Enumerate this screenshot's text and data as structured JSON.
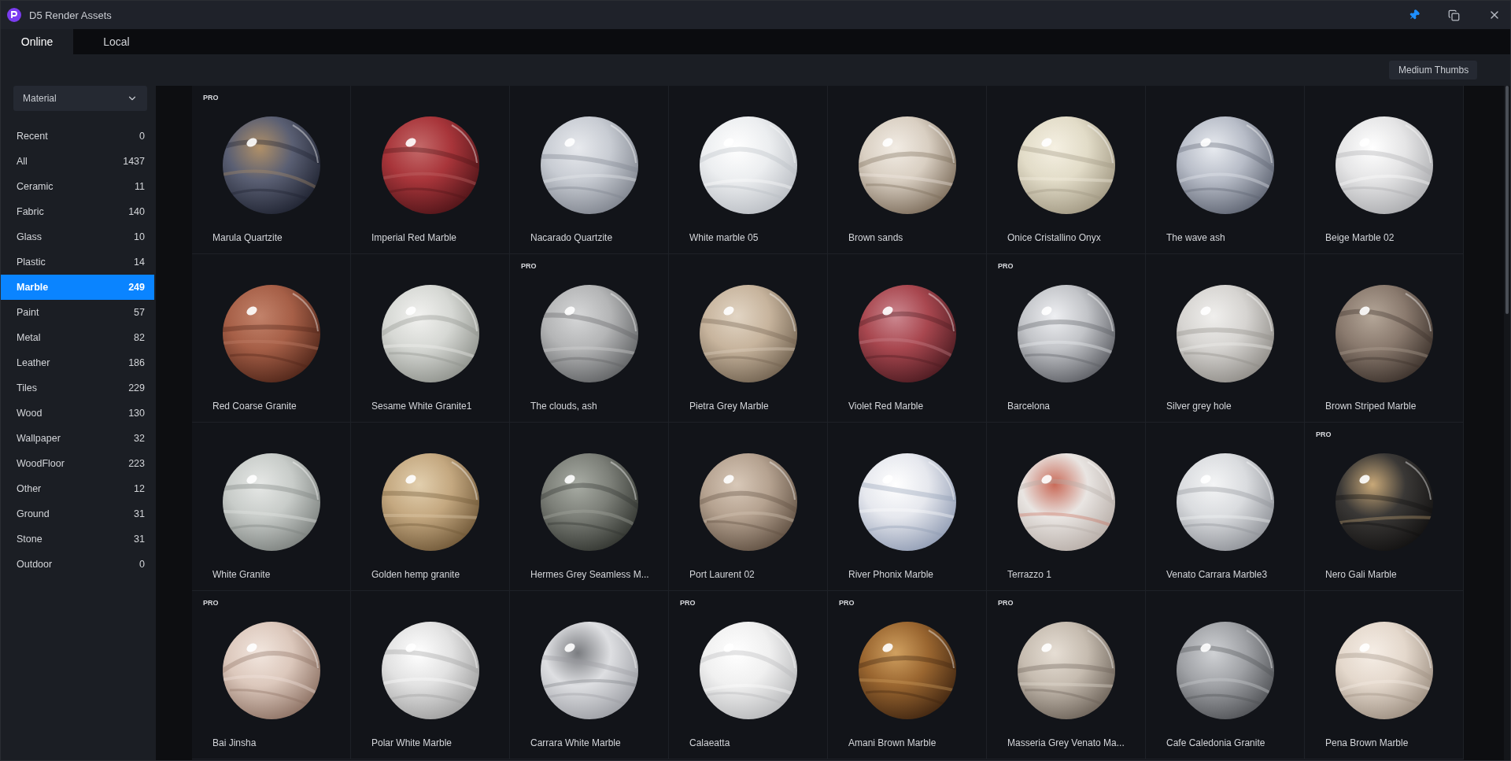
{
  "window": {
    "title": "D5 Render Assets"
  },
  "tabs": [
    {
      "label": "Online",
      "selected": true
    },
    {
      "label": "Local",
      "selected": false
    }
  ],
  "thumb_size_dropdown": {
    "value": "Medium Thumbs"
  },
  "category_dropdown": {
    "value": "Material"
  },
  "categories": [
    {
      "name": "Recent",
      "count": "0",
      "selected": false
    },
    {
      "name": "All",
      "count": "1437",
      "selected": false
    },
    {
      "name": "Ceramic",
      "count": "11",
      "selected": false
    },
    {
      "name": "Fabric",
      "count": "140",
      "selected": false
    },
    {
      "name": "Glass",
      "count": "10",
      "selected": false
    },
    {
      "name": "Plastic",
      "count": "14",
      "selected": false
    },
    {
      "name": "Marble",
      "count": "249",
      "selected": true
    },
    {
      "name": "Paint",
      "count": "57",
      "selected": false
    },
    {
      "name": "Metal",
      "count": "82",
      "selected": false
    },
    {
      "name": "Leather",
      "count": "186",
      "selected": false
    },
    {
      "name": "Tiles",
      "count": "229",
      "selected": false
    },
    {
      "name": "Wood",
      "count": "130",
      "selected": false
    },
    {
      "name": "Wallpaper",
      "count": "32",
      "selected": false
    },
    {
      "name": "WoodFloor",
      "count": "223",
      "selected": false
    },
    {
      "name": "Other",
      "count": "12",
      "selected": false
    },
    {
      "name": "Ground",
      "count": "31",
      "selected": false
    },
    {
      "name": "Stone",
      "count": "31",
      "selected": false
    },
    {
      "name": "Outdoor",
      "count": "0",
      "selected": false
    }
  ],
  "assets": [
    {
      "name": "Marula Quartzite",
      "badge": "PRO"
    },
    {
      "name": "Imperial Red Marble"
    },
    {
      "name": "Nacarado Quartzite"
    },
    {
      "name": "White marble 05"
    },
    {
      "name": "Brown sands"
    },
    {
      "name": "Onice Cristallino Onyx"
    },
    {
      "name": "The wave ash"
    },
    {
      "name": "Beige Marble 02"
    },
    {
      "name": "Red Coarse Granite"
    },
    {
      "name": "Sesame White Granite1"
    },
    {
      "name": "The clouds, ash",
      "badge": "PRO"
    },
    {
      "name": "Pietra Grey Marble"
    },
    {
      "name": "Violet Red Marble"
    },
    {
      "name": "Barcelona",
      "badge": "PRO"
    },
    {
      "name": "Silver grey hole"
    },
    {
      "name": "Brown Striped Marble"
    },
    {
      "name": "White Granite"
    },
    {
      "name": "Golden hemp granite"
    },
    {
      "name": "Hermes Grey Seamless M..."
    },
    {
      "name": "Port Laurent 02"
    },
    {
      "name": "River Phonix Marble"
    },
    {
      "name": "Terrazzo 1"
    },
    {
      "name": "Venato Carrara Marble3"
    },
    {
      "name": "Nero Gali Marble",
      "badge": "PRO"
    },
    {
      "name": "Bai Jinsha",
      "badge": "PRO"
    },
    {
      "name": "Polar White Marble"
    },
    {
      "name": "Carrara White Marble"
    },
    {
      "name": "Calaeatta",
      "badge": "PRO"
    },
    {
      "name": "Amani Brown Marble",
      "badge": "PRO"
    },
    {
      "name": "Masseria Grey Venato Ma...",
      "badge": "PRO"
    },
    {
      "name": "Cafe Caledonia Granite"
    },
    {
      "name": "Pena Brown Marble"
    }
  ]
}
